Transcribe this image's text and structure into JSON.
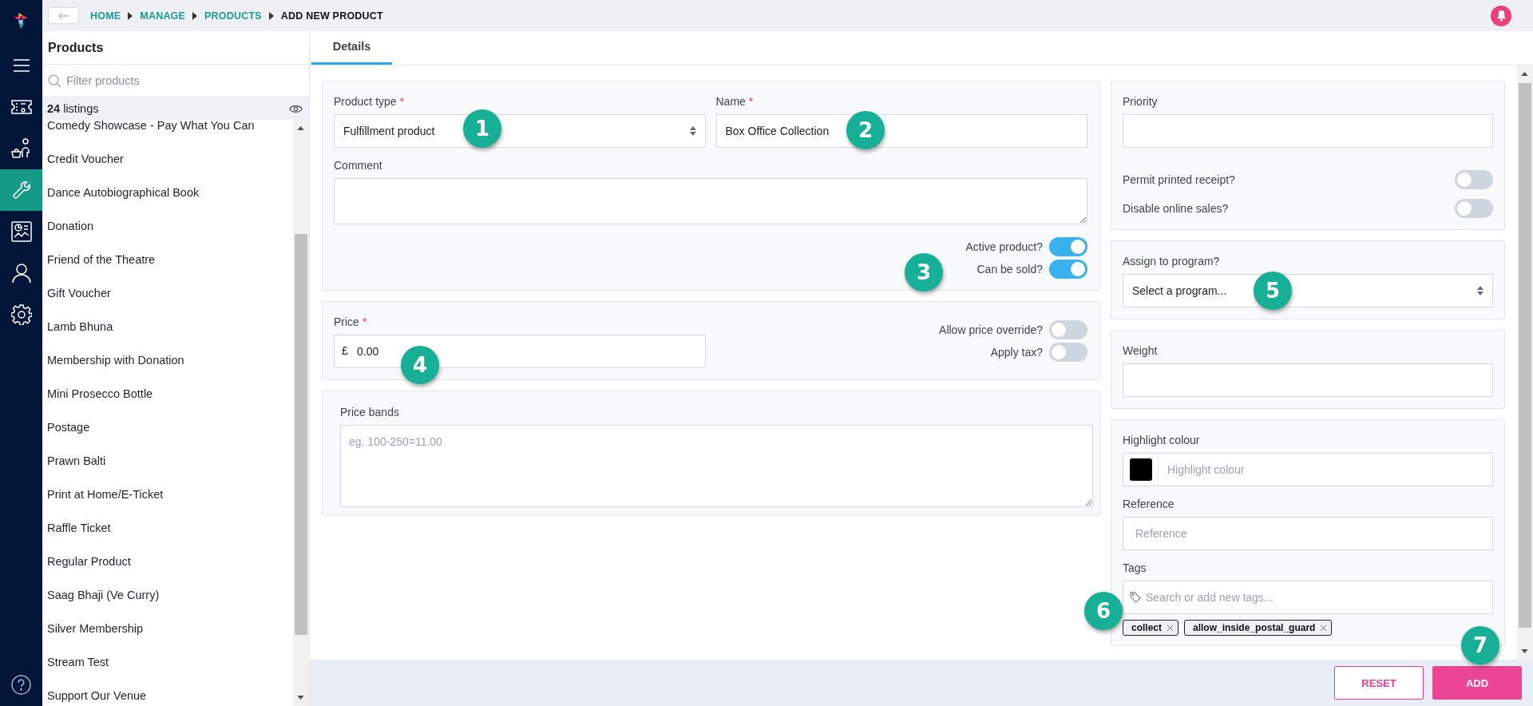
{
  "rail": {
    "items": [
      {
        "kind": "menu",
        "selected": false
      },
      {
        "kind": "ticket",
        "selected": false
      },
      {
        "kind": "customer",
        "selected": false
      },
      {
        "kind": "tools",
        "selected": true
      },
      {
        "kind": "reports",
        "selected": false
      },
      {
        "kind": "person",
        "selected": false
      },
      {
        "kind": "settings",
        "selected": false
      }
    ]
  },
  "breadcrumb": [
    "HOME",
    "MANAGE",
    "PRODUCTS",
    "ADD NEW PRODUCT"
  ],
  "products_panel": {
    "title": "Products",
    "filter": {
      "placeholder": "Filter products"
    },
    "count": "**24** listings",
    "items": [
      "Comedy Showcase - Pay What You Can",
      "Credit Voucher",
      "Dance Autobiographical Book",
      "Donation",
      "Friend of the Theatre",
      "Gift Voucher",
      "Lamb Bhuna",
      "Membership with Donation",
      "Mini Prosecco Bottle",
      "Postage",
      "Prawn Balti",
      "Print at Home/E-Ticket",
      "Raffle Ticket",
      "Regular Product",
      "Saag Bhaji (Ve Curry)",
      "Silver Membership",
      "Stream Test",
      "Support Our Venue"
    ]
  },
  "tabs": [
    {
      "label": "Details",
      "selected": true
    }
  ],
  "general": {
    "product_type": {
      "label": "Product type",
      "required_mark": "*",
      "value": "Fulfillment product"
    },
    "name": {
      "label": "Name",
      "required_mark": "*",
      "value": "Box Office Collection"
    },
    "comment": {
      "label": "Comment"
    },
    "toggles": [
      {
        "label": "Active product?",
        "on": true
      },
      {
        "label": "Can be sold?",
        "on": true
      }
    ]
  },
  "pricing": {
    "price": {
      "label": "Price",
      "required_mark": "*",
      "currency": "£",
      "value": "0.00"
    },
    "toggles": [
      {
        "label": "Allow price override?",
        "on": false
      },
      {
        "label": "Apply tax?",
        "on": false
      }
    ]
  },
  "price_bands": {
    "label": "Price bands",
    "placeholder": "eg. 100-250=11.00"
  },
  "priority": {
    "label": "Priority",
    "toggles": [
      {
        "label": "Permit printed receipt?",
        "on": false
      },
      {
        "label": "Disable online sales?",
        "on": false
      }
    ]
  },
  "program": {
    "label": "Assign to program?",
    "value": "Select a program..."
  },
  "weight": {
    "label": "Weight"
  },
  "extras": {
    "highlight": {
      "label": "Highlight colour",
      "placeholder": "Highlight colour"
    },
    "reference": {
      "label": "Reference",
      "placeholder": "Reference"
    },
    "tags": {
      "label": "Tags",
      "placeholder": "Search or add new tags...",
      "items": [
        "collect",
        "allow_inside_postal_guard"
      ]
    }
  },
  "buttons": [
    {
      "label": "RESET",
      "kind": "secondary"
    },
    {
      "label": "ADD",
      "kind": "primary"
    }
  ],
  "callouts": [
    "1",
    "2",
    "3",
    "4",
    "5",
    "6",
    "7"
  ]
}
